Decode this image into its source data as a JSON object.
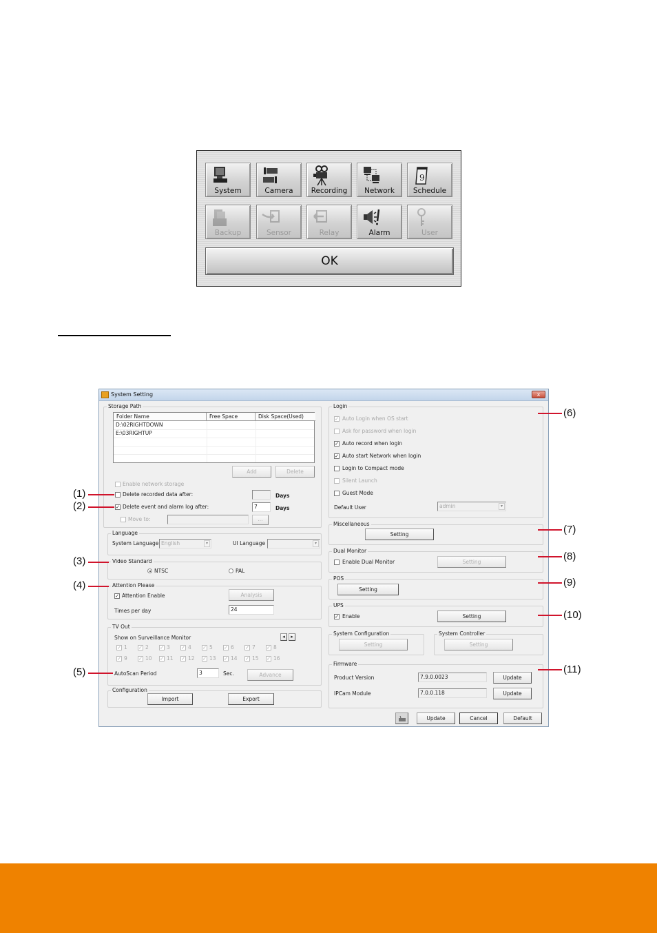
{
  "setup_menu": {
    "buttons": [
      {
        "label": "System",
        "icon": "monitor-icon",
        "enabled": true
      },
      {
        "label": "Camera",
        "icon": "camera-icon",
        "enabled": true
      },
      {
        "label": "Recording",
        "icon": "movie-camera-icon",
        "enabled": true
      },
      {
        "label": "Network",
        "icon": "network-icon",
        "enabled": true
      },
      {
        "label": "Schedule",
        "icon": "calendar-icon",
        "enabled": true
      },
      {
        "label": "Backup",
        "icon": "backup-icon",
        "enabled": false
      },
      {
        "label": "Sensor",
        "icon": "sensor-icon",
        "enabled": false
      },
      {
        "label": "Relay",
        "icon": "relay-icon",
        "enabled": false
      },
      {
        "label": "Alarm",
        "icon": "alarm-icon",
        "enabled": true
      },
      {
        "label": "User",
        "icon": "key-icon",
        "enabled": false
      }
    ],
    "ok_label": "OK"
  },
  "window": {
    "title": "System Setting",
    "close_label": "x",
    "storage": {
      "title": "Storage Path",
      "columns": [
        "Folder Name",
        "Free Space",
        "Disk Space(Used)"
      ],
      "rows": [
        [
          "D:\\02RIGHTDOWN",
          "",
          ""
        ],
        [
          "E:\\03RIGHTUP",
          "",
          ""
        ]
      ],
      "add_label": "Add",
      "delete_label": "Delete",
      "enable_network_storage": "Enable network storage",
      "delete_recorded": "Delete recorded data after:",
      "delete_recorded_value": "",
      "delete_event": "Delete event and alarm log after:",
      "delete_event_value": "7",
      "days": "Days",
      "move_to": "Move to:",
      "browse": "..."
    },
    "language": {
      "title": "Language",
      "system_language_label": "System Language",
      "system_language_value": "English",
      "ui_language_label": "UI Language",
      "ui_language_value": ""
    },
    "video_standard": {
      "title": "Video Standard",
      "options": [
        "NTSC",
        "PAL"
      ],
      "selected": "NTSC"
    },
    "attention": {
      "title": "Attention Please",
      "enable_label": "Attention Enable",
      "analysis_label": "Analysis",
      "times_label": "Times per day",
      "times_value": "24"
    },
    "tv_out": {
      "title": "TV Out",
      "show_label": "Show on Surveillance Monitor",
      "channels": [
        "1",
        "2",
        "3",
        "4",
        "5",
        "6",
        "7",
        "8",
        "9",
        "10",
        "11",
        "12",
        "13",
        "14",
        "15",
        "16"
      ],
      "autoscan_label": "AutoScan Period",
      "autoscan_value": "3",
      "sec_label": "Sec.",
      "advance_label": "Advance",
      "prev_arrow": "◂",
      "next_arrow": "▸"
    },
    "configuration": {
      "title": "Configuration",
      "import_label": "Import",
      "export_label": "Export"
    },
    "login": {
      "title": "Login",
      "options": [
        {
          "label": "Auto Login when OS start",
          "checked": true,
          "enabled": false
        },
        {
          "label": "Ask for password when login",
          "checked": false,
          "enabled": false
        },
        {
          "label": "Auto record when login",
          "checked": true,
          "enabled": true
        },
        {
          "label": "Auto start Network when login",
          "checked": true,
          "enabled": true
        },
        {
          "label": "Login to Compact mode",
          "checked": false,
          "enabled": true
        },
        {
          "label": "Silent Launch",
          "checked": false,
          "enabled": false
        },
        {
          "label": "Guest Mode",
          "checked": false,
          "enabled": true
        }
      ],
      "default_user_label": "Default User",
      "default_user_value": "admin"
    },
    "miscellaneous": {
      "title": "Miscellaneous",
      "setting_label": "Setting"
    },
    "dual_monitor": {
      "title": "Dual Monitor",
      "enable_label": "Enable Dual Monitor",
      "setting_label": "Setting"
    },
    "pos": {
      "title": "POS",
      "setting_label": "Setting"
    },
    "ups": {
      "title": "UPS",
      "enable_label": "Enable",
      "setting_label": "Setting"
    },
    "system_configuration": {
      "title": "System Configuration",
      "setting_label": "Setting"
    },
    "system_controller": {
      "title": "System Controller",
      "setting_label": "Setting"
    },
    "firmware": {
      "title": "Firmware",
      "product_version_label": "Product Version",
      "product_version_value": "7.9.0.0023",
      "ipcam_label": "IPCam Module",
      "ipcam_value": "7.0.0.118",
      "update_label": "Update"
    },
    "footer": {
      "update_label": "Update",
      "cancel_label": "Cancel",
      "default_label": "Default"
    }
  },
  "callouts": [
    "(1)",
    "(2)",
    "(3)",
    "(4)",
    "(5)",
    "(6)",
    "(7)",
    "(8)",
    "(9)",
    "(10)",
    "(11)"
  ],
  "colors": {
    "callout_line": "#d0142c",
    "footer_bar": "#ef8200",
    "window_bg": "#f0f0f0"
  }
}
